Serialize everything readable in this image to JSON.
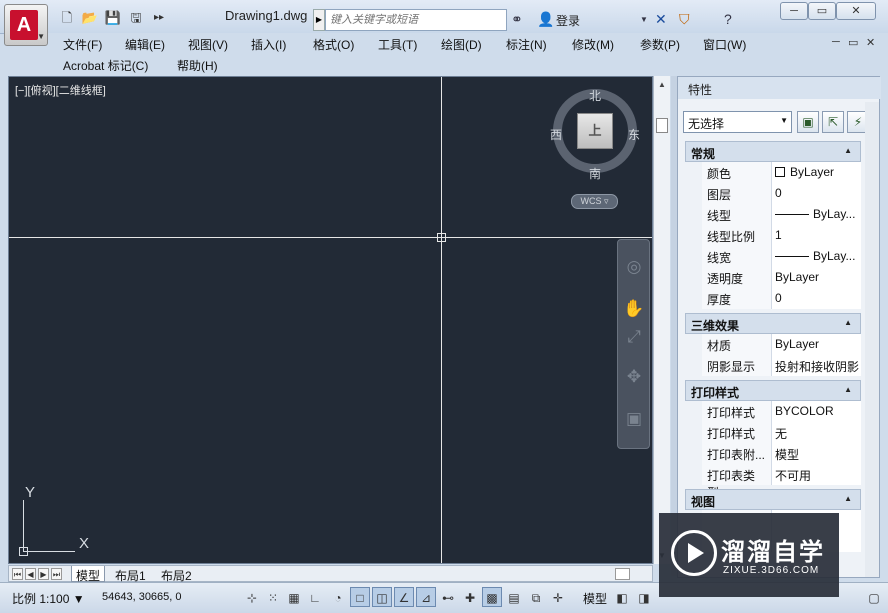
{
  "window": {
    "doc_title": "Drawing1.dwg",
    "search_placeholder": "键入关键字或短语",
    "login_label": "登录",
    "quick_access": [
      "new-icon",
      "open-icon",
      "save-icon",
      "saveas-icon",
      "more-icon"
    ]
  },
  "menu": {
    "row1": [
      "文件(F)",
      "编辑(E)",
      "视图(V)",
      "插入(I)",
      "格式(O)",
      "工具(T)",
      "绘图(D)",
      "标注(N)",
      "修改(M)",
      "参数(P)",
      "窗口(W)"
    ],
    "row2": [
      "Acrobat 标记(C)",
      "帮助(H)"
    ]
  },
  "viewport": {
    "label": "[−][俯视][二维线框]",
    "compass": {
      "north": "北",
      "south": "南",
      "east": "东",
      "west": "西",
      "center": "上"
    },
    "wcs_label": "WCS",
    "ucs_y": "Y",
    "ucs_x": "X"
  },
  "properties": {
    "title": "特性",
    "selection": "无选择",
    "categories": [
      {
        "name": "常规",
        "rows": [
          {
            "key": "颜色",
            "value": "ByLayer",
            "kind": "color"
          },
          {
            "key": "图层",
            "value": "0"
          },
          {
            "key": "线型",
            "value": "ByLay...",
            "kind": "line"
          },
          {
            "key": "线型比例",
            "value": "1"
          },
          {
            "key": "线宽",
            "value": "ByLay...",
            "kind": "line"
          },
          {
            "key": "透明度",
            "value": "ByLayer"
          },
          {
            "key": "厚度",
            "value": "0"
          }
        ]
      },
      {
        "name": "三维效果",
        "rows": [
          {
            "key": "材质",
            "value": "ByLayer"
          },
          {
            "key": "阴影显示",
            "value": "投射和接收阴影"
          }
        ]
      },
      {
        "name": "打印样式",
        "rows": [
          {
            "key": "打印样式",
            "value": "BYCOLOR"
          },
          {
            "key": "打印样式表",
            "value": "无"
          },
          {
            "key": "打印表附...",
            "value": "模型"
          },
          {
            "key": "打印表类型",
            "value": "不可用"
          }
        ]
      },
      {
        "name": "视图",
        "rows": []
      }
    ]
  },
  "layout_tabs": [
    "模型",
    "布局1",
    "布局2"
  ],
  "statusbar": {
    "scale": "比例 1:100",
    "coords": "54643, 30665, 0",
    "model": "模型"
  },
  "watermark": {
    "title": "溜溜自学",
    "sub": "ZIXUE.3D66.COM"
  },
  "colors": {
    "canvas": "#222a36",
    "accent": "#c8102e"
  }
}
